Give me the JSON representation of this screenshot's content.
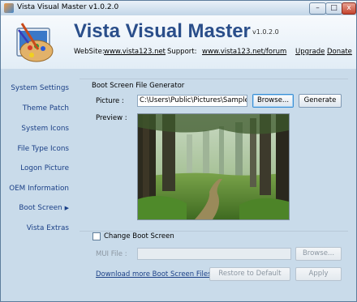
{
  "window": {
    "title": "Vista Visual Master v1.0.2.0",
    "min_glyph": "–",
    "max_glyph": "□",
    "close_glyph": "x"
  },
  "header": {
    "app_name": "Vista Visual Master",
    "version": "v1.0.2.0",
    "website_label": "WebSite:",
    "website_link": "www.vista123.net",
    "support_label": "Support:",
    "support_link": "www.vista123.net/forum",
    "upgrade_link": "Upgrade",
    "donate_link": "Donate"
  },
  "sidebar": {
    "items": [
      {
        "label": "System Settings"
      },
      {
        "label": "Theme Patch"
      },
      {
        "label": "System Icons"
      },
      {
        "label": "File Type Icons"
      },
      {
        "label": "Logon Picture"
      },
      {
        "label": "OEM Information"
      },
      {
        "label": "Boot Screen",
        "active": true,
        "arrow": "▶"
      },
      {
        "label": "Vista Extras"
      }
    ]
  },
  "generator": {
    "group_title": "Boot Screen File Generator",
    "picture_label": "Picture :",
    "picture_value": "C:\\Users\\Public\\Pictures\\Sample Pi",
    "browse_label": "Browse...",
    "generate_label": "Generate",
    "preview_label": "Preview :"
  },
  "change": {
    "checkbox_label": "Change Boot Screen",
    "checked": false,
    "mui_label": "MUI File :",
    "mui_value": "",
    "browse_label": "Browse...",
    "download_link": "Download more Boot Screen Files",
    "restore_label": "Restore to Default",
    "apply_label": "Apply"
  },
  "colors": {
    "background": "#c9dbea",
    "link": "#1a3f86",
    "title_blue": "#2a4e8a"
  }
}
